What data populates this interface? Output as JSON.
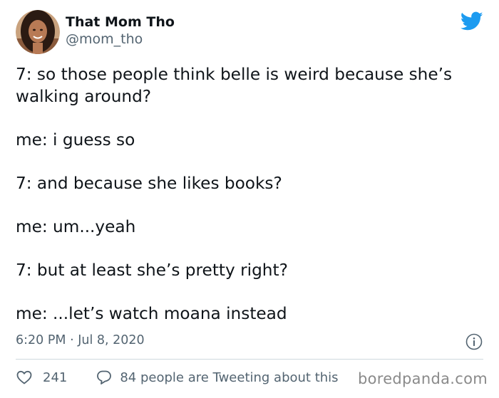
{
  "author": {
    "display_name": "That Mom Tho",
    "handle": "@mom_tho"
  },
  "tweet": {
    "lines": [
      "7: so those people think belle is weird because she’s walking around?",
      "me: i guess so",
      "7: and because she likes books?",
      "me: um...yeah",
      "7: but at least she’s pretty right?",
      "me: ...let’s watch moana instead"
    ],
    "timestamp": "6:20 PM · Jul 8, 2020"
  },
  "actions": {
    "like_count": "241",
    "conversation_label": "84 people are Tweeting about this"
  },
  "watermark": "boredpanda.com",
  "icons": {
    "brand": "twitter-bird-icon",
    "info": "info-icon",
    "like": "heart-icon",
    "reply": "comment-bubble-icon"
  },
  "colors": {
    "twitter_blue": "#1d9bf0",
    "text_primary": "#0f1419",
    "text_secondary": "#536471",
    "divider": "#cfd9de",
    "watermark": "#8a8a8a"
  }
}
